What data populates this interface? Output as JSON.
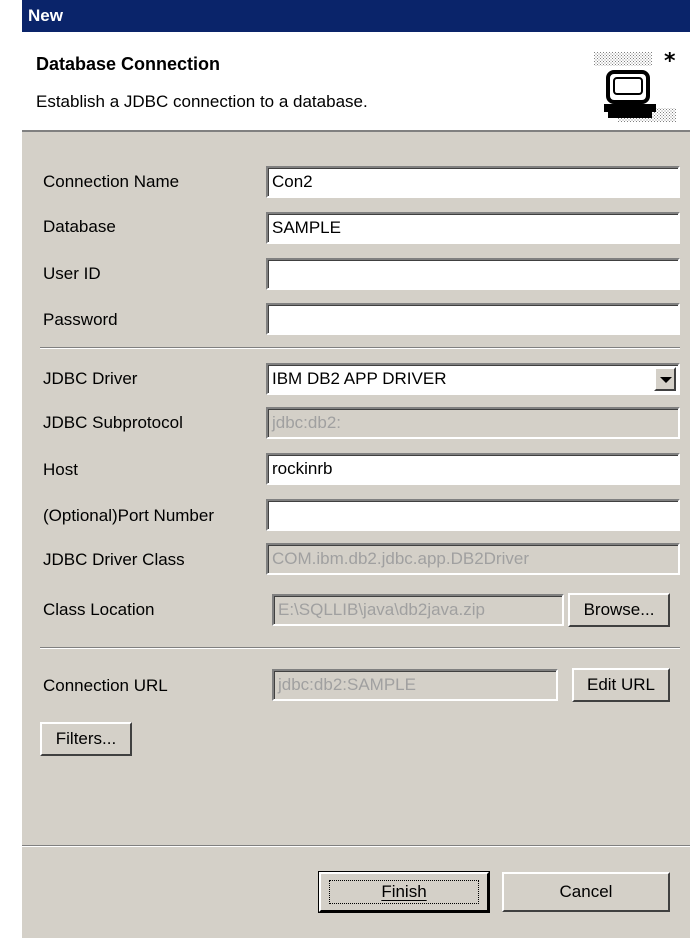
{
  "window": {
    "title": "New"
  },
  "banner": {
    "title": "Database Connection",
    "description": "Establish a JDBC connection to a database.",
    "icon": "database-connection-icon"
  },
  "form": {
    "connection_name": {
      "label": "Connection Name",
      "value": "Con2"
    },
    "database": {
      "label": "Database",
      "value": "SAMPLE"
    },
    "user_id": {
      "label": "User ID",
      "value": ""
    },
    "password": {
      "label": "Password",
      "value": ""
    },
    "jdbc_driver": {
      "label": "JDBC Driver",
      "value": "IBM DB2 APP DRIVER"
    },
    "jdbc_subprotocol": {
      "label": "JDBC Subprotocol",
      "value": "jdbc:db2:"
    },
    "host": {
      "label": "Host",
      "value": "rockinrb"
    },
    "port_number": {
      "label": "(Optional)Port Number",
      "value": ""
    },
    "jdbc_driver_class": {
      "label": "JDBC Driver Class",
      "value": "COM.ibm.db2.jdbc.app.DB2Driver"
    },
    "class_location": {
      "label": "Class Location",
      "value": "E:\\SQLLIB\\java\\db2java.zip",
      "browse_label": "Browse..."
    },
    "connection_url": {
      "label": "Connection URL",
      "value": "jdbc:db2:SAMPLE",
      "edit_label": "Edit URL"
    },
    "filters_label": "Filters..."
  },
  "footer": {
    "finish_label": "Finish",
    "cancel_label": "Cancel"
  },
  "colors": {
    "titlebar": "#0a246a",
    "dialog": "#d4d0c8",
    "disabled_text": "#a0a0a0"
  }
}
